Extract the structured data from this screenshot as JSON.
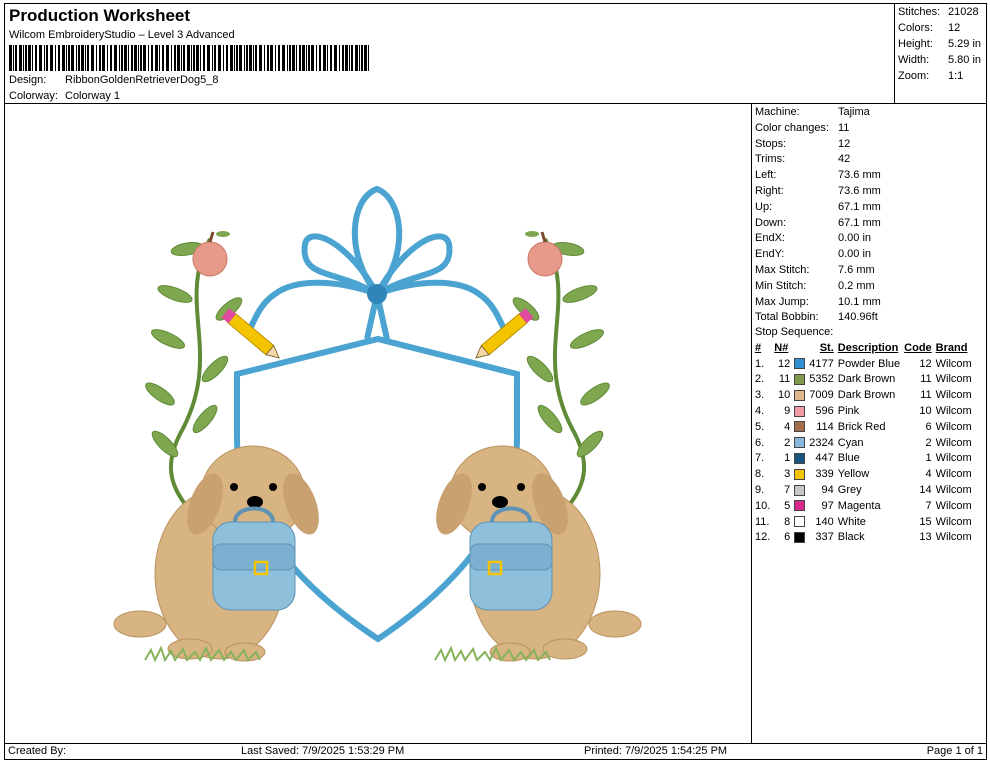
{
  "header": {
    "title": "Production Worksheet",
    "subtitle": "Wilcom EmbroideryStudio – Level 3 Advanced",
    "design_label": "Design:",
    "design_value": "RibbonGoldenRetrieverDog5_8",
    "colorway_label": "Colorway:",
    "colorway_value": "Colorway 1"
  },
  "stats": [
    {
      "label": "Stitches:",
      "value": "21028"
    },
    {
      "label": "Colors:",
      "value": "12"
    },
    {
      "label": "Height:",
      "value": "5.29 in"
    },
    {
      "label": "Width:",
      "value": "5.80 in"
    },
    {
      "label": "Zoom:",
      "value": "1:1"
    }
  ],
  "info": [
    {
      "label": "Machine:",
      "value": "Tajima"
    },
    {
      "label": "Color changes:",
      "value": "11"
    },
    {
      "label": "Stops:",
      "value": "12"
    },
    {
      "label": "Trims:",
      "value": "42"
    },
    {
      "label": "Left:",
      "value": "73.6 mm"
    },
    {
      "label": "Right:",
      "value": "73.6 mm"
    },
    {
      "label": "Up:",
      "value": "67.1 mm"
    },
    {
      "label": "Down:",
      "value": "67.1 mm"
    },
    {
      "label": "EndX:",
      "value": "0.00 in"
    },
    {
      "label": "EndY:",
      "value": "0.00 in"
    },
    {
      "label": "Max Stitch:",
      "value": "7.6 mm"
    },
    {
      "label": "Min Stitch:",
      "value": "0.2 mm"
    },
    {
      "label": "Max Jump:",
      "value": "10.1 mm"
    },
    {
      "label": "Total Bobbin:",
      "value": "140.96ft"
    }
  ],
  "stop_sequence": {
    "label": "Stop Sequence:",
    "columns": [
      "#",
      "N#",
      "St.",
      "Description",
      "Code",
      "Brand"
    ],
    "rows": [
      {
        "idx": "1.",
        "n": "12",
        "color": "#2f8fd3",
        "st": "4177",
        "desc": "Powder Blue",
        "code": "12",
        "brand": "Wilcom"
      },
      {
        "idx": "2.",
        "n": "11",
        "color": "#7f9a4f",
        "st": "5352",
        "desc": "Dark Brown",
        "code": "11",
        "brand": "Wilcom"
      },
      {
        "idx": "3.",
        "n": "10",
        "color": "#ddb88d",
        "st": "7009",
        "desc": "Dark Brown",
        "code": "11",
        "brand": "Wilcom"
      },
      {
        "idx": "4.",
        "n": "9",
        "color": "#f09aa6",
        "st": "596",
        "desc": "Pink",
        "code": "10",
        "brand": "Wilcom"
      },
      {
        "idx": "5.",
        "n": "4",
        "color": "#a36d4e",
        "st": "114",
        "desc": "Brick Red",
        "code": "6",
        "brand": "Wilcom"
      },
      {
        "idx": "6.",
        "n": "2",
        "color": "#8ab6dc",
        "st": "2324",
        "desc": "Cyan",
        "code": "2",
        "brand": "Wilcom"
      },
      {
        "idx": "7.",
        "n": "1",
        "color": "#17557f",
        "st": "447",
        "desc": "Blue",
        "code": "1",
        "brand": "Wilcom"
      },
      {
        "idx": "8.",
        "n": "3",
        "color": "#f5c400",
        "st": "339",
        "desc": "Yellow",
        "code": "4",
        "brand": "Wilcom"
      },
      {
        "idx": "9.",
        "n": "7",
        "color": "#c7c7c7",
        "st": "94",
        "desc": "Grey",
        "code": "14",
        "brand": "Wilcom"
      },
      {
        "idx": "10.",
        "n": "5",
        "color": "#d8298a",
        "st": "97",
        "desc": "Magenta",
        "code": "7",
        "brand": "Wilcom"
      },
      {
        "idx": "11.",
        "n": "8",
        "color": "#ffffff",
        "st": "140",
        "desc": "White",
        "code": "15",
        "brand": "Wilcom"
      },
      {
        "idx": "12.",
        "n": "6",
        "color": "#000000",
        "st": "337",
        "desc": "Black",
        "code": "13",
        "brand": "Wilcom"
      }
    ]
  },
  "footer": {
    "created_by": "Created By:",
    "last_saved": "Last Saved: 7/9/2025 1:53:29 PM",
    "printed": "Printed: 7/9/2025 1:54:25 PM",
    "page": "Page 1 of 1"
  },
  "design_preview": {
    "colors": {
      "ribbon": "#4aa3d1",
      "ribbon_dark": "#2e86b8",
      "leaf": "#7fa74f",
      "leaf_dark": "#5f8a36",
      "dog": "#d9b483",
      "dog_dark": "#b8915e",
      "backpack": "#8ebfdb",
      "apple": "#e79a8a",
      "pencil": "#f5c400",
      "eraser": "#e04aa0",
      "grass": "#86b35a"
    }
  }
}
